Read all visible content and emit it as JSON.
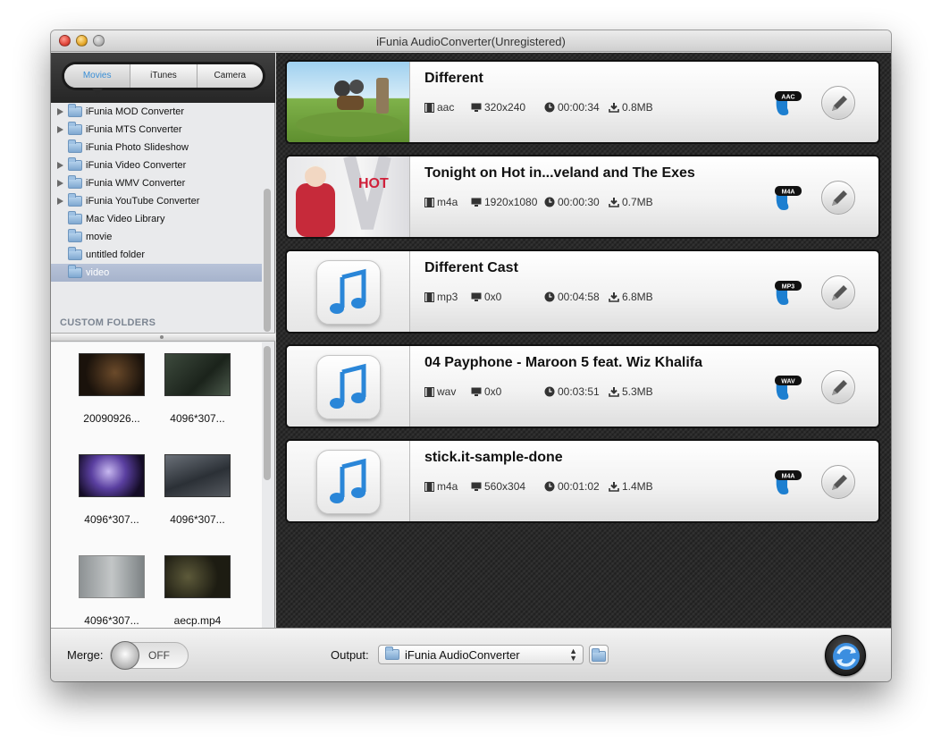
{
  "window": {
    "title": "iFunia AudioConverter(Unregistered)"
  },
  "sidebar": {
    "tabs": [
      {
        "label": "Movies",
        "active": true
      },
      {
        "label": "iTunes",
        "active": false
      },
      {
        "label": "Camera",
        "active": false
      }
    ],
    "folders": [
      {
        "label": "iFunia MOD Converter",
        "expandable": true
      },
      {
        "label": "iFunia MTS Converter",
        "expandable": true
      },
      {
        "label": "iFunia Photo Slideshow",
        "expandable": false
      },
      {
        "label": "iFunia Video Converter",
        "expandable": true
      },
      {
        "label": "iFunia WMV Converter",
        "expandable": true
      },
      {
        "label": "iFunia YouTube Converter",
        "expandable": true
      },
      {
        "label": "Mac Video Library",
        "expandable": false
      },
      {
        "label": "movie",
        "expandable": false
      },
      {
        "label": "untitled folder",
        "expandable": false
      },
      {
        "label": "video",
        "expandable": false,
        "selected": true
      }
    ],
    "custom_folders_label": "CUSTOM FOLDERS",
    "thumbnails": [
      {
        "caption": "20090926..."
      },
      {
        "caption": "4096*307..."
      },
      {
        "caption": "4096*307..."
      },
      {
        "caption": "4096*307..."
      },
      {
        "caption": "4096*307..."
      },
      {
        "caption": "aecp.mp4"
      }
    ]
  },
  "files": [
    {
      "name": "Different",
      "format": "aac",
      "resolution": "320x240",
      "duration": "00:00:34",
      "size": "0.8MB",
      "badge": "AAC",
      "thumb": "video"
    },
    {
      "name": "Tonight on Hot in...veland and The Exes",
      "format": "m4a",
      "resolution": "1920x1080",
      "duration": "00:00:30",
      "size": "0.7MB",
      "badge": "M4A",
      "thumb": "video",
      "thumb_text": "HOT"
    },
    {
      "name": "Different Cast",
      "format": "mp3",
      "resolution": "0x0",
      "duration": "00:04:58",
      "size": "6.8MB",
      "badge": "MP3",
      "thumb": "music"
    },
    {
      "name": "04 Payphone - Maroon 5 feat. Wiz Khalifa",
      "format": "wav",
      "resolution": "0x0",
      "duration": "00:03:51",
      "size": "5.3MB",
      "badge": "WAV",
      "thumb": "music"
    },
    {
      "name": "stick.it-sample-done",
      "format": "m4a",
      "resolution": "560x304",
      "duration": "00:01:02",
      "size": "1.4MB",
      "badge": "M4A",
      "thumb": "music"
    }
  ],
  "bottom": {
    "merge_label": "Merge:",
    "merge_state": "OFF",
    "output_label": "Output:",
    "output_value": "iFunia AudioConverter"
  },
  "colors": {
    "accent": "#3a8fd6",
    "badge_blue": "#1d7fd0",
    "list_bg": "#2b2b2b",
    "selected_row": "#a6b3cc"
  },
  "icons": [
    "film-icon",
    "monitor-icon",
    "clock-icon",
    "download-icon",
    "pencil-icon",
    "folder-icon",
    "music-note-icon",
    "convert-icon"
  ]
}
